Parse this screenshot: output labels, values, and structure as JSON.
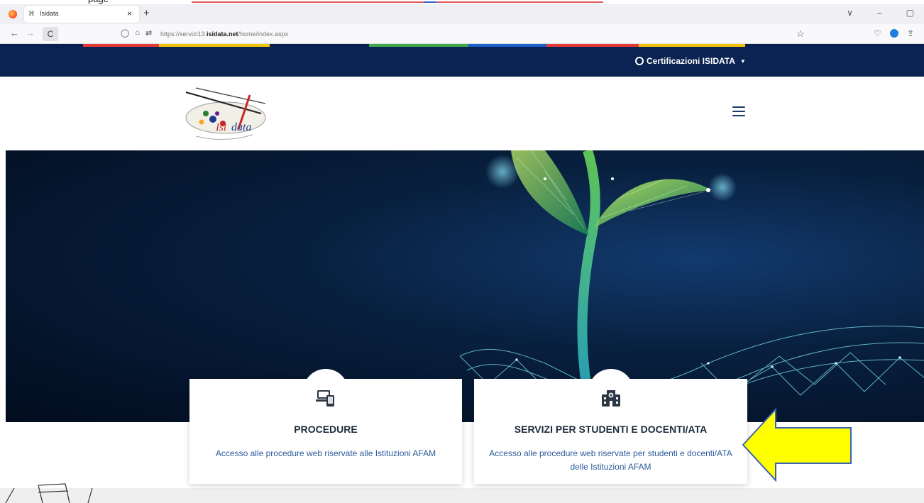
{
  "doc": {
    "text": "page"
  },
  "browser": {
    "tab_title": "Isidata",
    "tab_favicon": "⌘",
    "tab_close": "×",
    "new_tab": "+",
    "url_prefix": "https://servizi13.",
    "url_domain": "isidata.net",
    "url_path": "/home/index.aspx",
    "back": "←",
    "forward": "→",
    "reload": "C",
    "minimize": "–",
    "restore": "▢",
    "tab_list": "∨",
    "star": "☆"
  },
  "site": {
    "cert_label": "Certificazioni ISIDATA",
    "logo_text": "Isidata"
  },
  "cards": [
    {
      "title": "PROCEDURE",
      "description": "Accesso alle procedure web riservate alle Istituzioni AFAM",
      "icon": "devices-icon"
    },
    {
      "title": "SERVIZI PER STUDENTI E DOCENTI/ATA",
      "description": "Accesso alle procedure web riservate per studenti e docenti/ATA delle Istituzioni AFAM",
      "icon": "school-icon"
    }
  ],
  "colors": {
    "header": "#0b2352",
    "accent_arrow": "#ffff00",
    "card_desc": "#2b5b9a"
  }
}
